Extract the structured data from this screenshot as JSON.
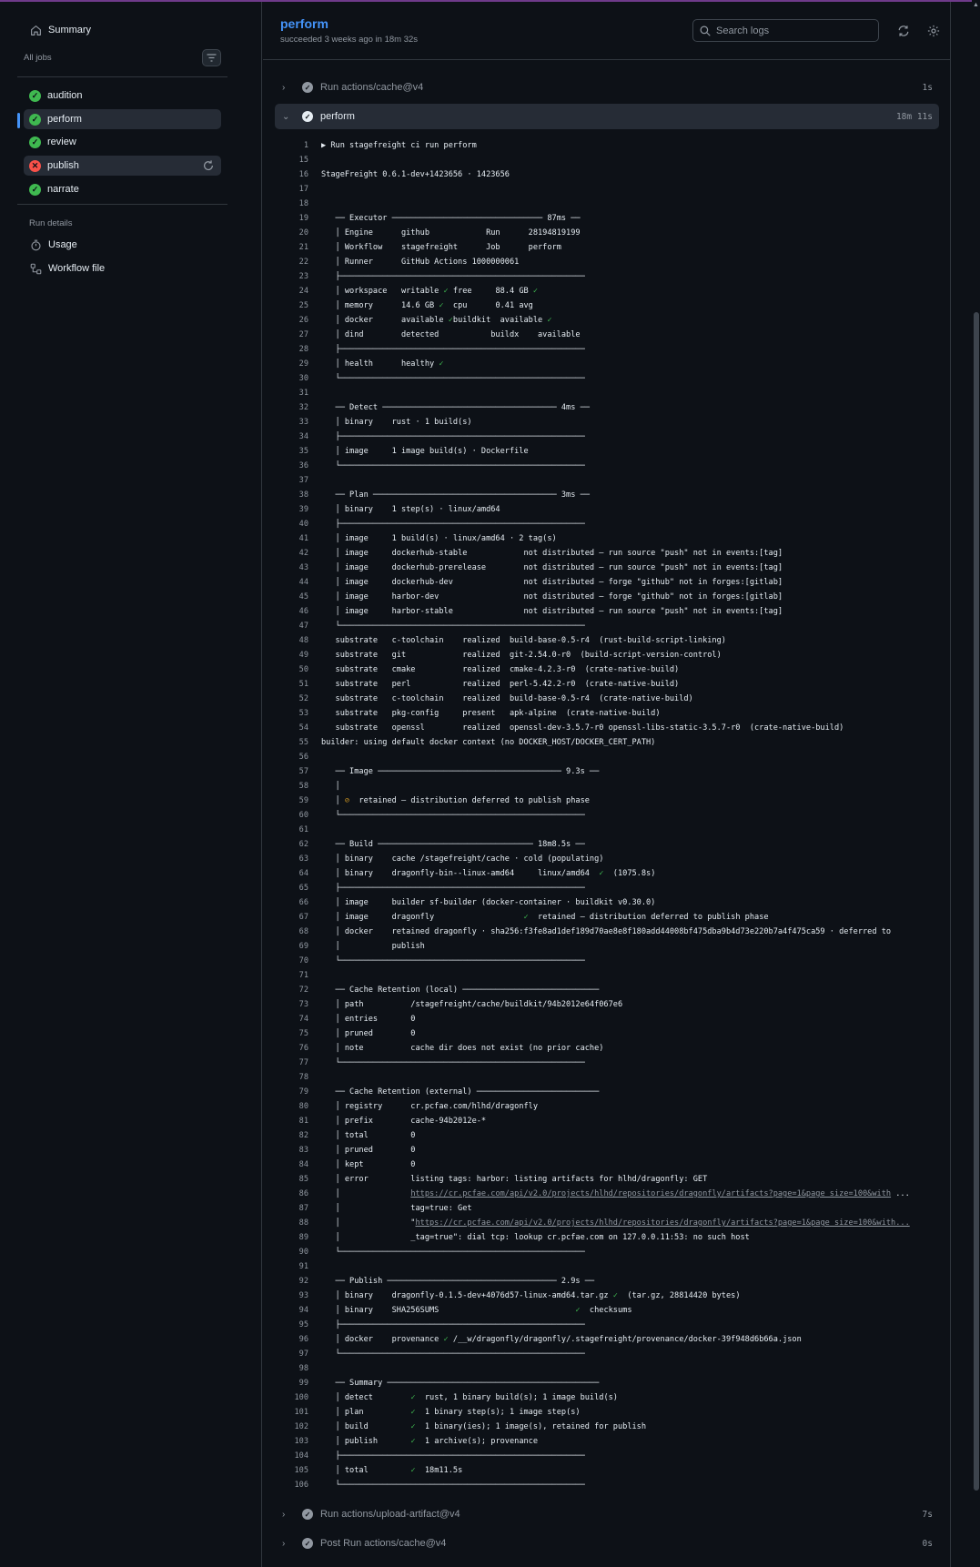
{
  "sidebar": {
    "summary": "Summary",
    "all_jobs": "All jobs",
    "jobs": [
      {
        "name": "audition",
        "status": "success"
      },
      {
        "name": "perform",
        "status": "success"
      },
      {
        "name": "review",
        "status": "success"
      },
      {
        "name": "publish",
        "status": "failure"
      },
      {
        "name": "narrate",
        "status": "success"
      }
    ],
    "run_details": "Run details",
    "usage": "Usage",
    "workflow_file": "Workflow file"
  },
  "header": {
    "title": "perform",
    "subtitle": "succeeded 3 weeks ago in 18m 32s",
    "search_placeholder": "Search logs"
  },
  "steps": {
    "cache": {
      "name": "Run actions/cache@v4",
      "duration": "1s"
    },
    "perform": {
      "name": "perform",
      "duration": "18m 11s"
    },
    "upload": {
      "name": "Run actions/upload-artifact@v4",
      "duration": "7s"
    },
    "post_cache": {
      "name": "Post Run actions/cache@v4",
      "duration": "0s"
    }
  },
  "log_lines": [
    {
      "n": "1",
      "t": "▶ Run stagefreight ci run perform"
    },
    {
      "n": "15",
      "t": ""
    },
    {
      "n": "16",
      "t": "StageFreight 0.6.1-dev+1423656 · 1423656",
      "c": "cyan"
    },
    {
      "n": "17",
      "t": ""
    },
    {
      "n": "18",
      "t": ""
    },
    {
      "n": "19",
      "t": "   ── Executor ──────────────────────────────── 87ms ──",
      "c": "cyan"
    },
    {
      "n": "20",
      "t": "   │ Engine      github            Run      28194819199"
    },
    {
      "n": "21",
      "t": "   │ Workflow    stagefreight      Job      perform"
    },
    {
      "n": "22",
      "t": "   │ Runner      GitHub Actions 1000000061"
    },
    {
      "n": "23",
      "t": "   ├────────────────────────────────────────────────────"
    },
    {
      "n": "24",
      "t": "   │ workspace   writable ✓ free     88.4 GB ✓"
    },
    {
      "n": "25",
      "t": "   │ memory      14.6 GB ✓  cpu      0.41 avg"
    },
    {
      "n": "26",
      "t": "   │ docker      available ✓buildkit  available ✓"
    },
    {
      "n": "27",
      "t": "   │ dind        detected           buildx    available"
    },
    {
      "n": "28",
      "t": "   ├────────────────────────────────────────────────────"
    },
    {
      "n": "29",
      "t": "   │ health      healthy ✓"
    },
    {
      "n": "30",
      "t": "   └────────────────────────────────────────────────────"
    },
    {
      "n": "31",
      "t": ""
    },
    {
      "n": "32",
      "t": "   ── Detect ───────────────────────────────────── 4ms ──",
      "c": "cyan"
    },
    {
      "n": "33",
      "t": "   │ binary    rust · 1 build(s)"
    },
    {
      "n": "34",
      "t": "   ├────────────────────────────────────────────────────"
    },
    {
      "n": "35",
      "t": "   │ image     1 image build(s) · Dockerfile"
    },
    {
      "n": "36",
      "t": "   └────────────────────────────────────────────────────"
    },
    {
      "n": "37",
      "t": ""
    },
    {
      "n": "38",
      "t": "   ── Plan ─────────────────────────────────────── 3ms ──",
      "c": "cyan"
    },
    {
      "n": "39",
      "t": "   │ binary    1 step(s) · linux/amd64"
    },
    {
      "n": "40",
      "t": "   ├────────────────────────────────────────────────────"
    },
    {
      "n": "41",
      "t": "   │ image     1 build(s) · linux/amd64 · 2 tag(s)"
    },
    {
      "n": "42",
      "t": "   │ image     dockerhub-stable            not distributed — run source \"push\" not in events:[tag]"
    },
    {
      "n": "43",
      "t": "   │ image     dockerhub-prerelease        not distributed — run source \"push\" not in events:[tag]"
    },
    {
      "n": "44",
      "t": "   │ image     dockerhub-dev               not distributed — forge \"github\" not in forges:[gitlab]"
    },
    {
      "n": "45",
      "t": "   │ image     harbor-dev                  not distributed — forge \"github\" not in forges:[gitlab]"
    },
    {
      "n": "46",
      "t": "   │ image     harbor-stable               not distributed — run source \"push\" not in events:[tag]"
    },
    {
      "n": "47",
      "t": "   └────────────────────────────────────────────────────"
    },
    {
      "n": "48",
      "t": "   substrate   c-toolchain    realized  build-base-0.5-r4  (rust-build-script-linking)"
    },
    {
      "n": "49",
      "t": "   substrate   git            realized  git-2.54.0-r0  (build-script-version-control)"
    },
    {
      "n": "50",
      "t": "   substrate   cmake          realized  cmake-4.2.3-r0  (crate-native-build)"
    },
    {
      "n": "51",
      "t": "   substrate   perl           realized  perl-5.42.2-r0  (crate-native-build)"
    },
    {
      "n": "52",
      "t": "   substrate   c-toolchain    realized  build-base-0.5-r4  (crate-native-build)"
    },
    {
      "n": "53",
      "t": "   substrate   pkg-config     present   apk-alpine  (crate-native-build)"
    },
    {
      "n": "54",
      "t": "   substrate   openssl        realized  openssl-dev-3.5.7-r0 openssl-libs-static-3.5.7-r0  (crate-native-build)"
    },
    {
      "n": "55",
      "t": "builder: using default docker context (no DOCKER_HOST/DOCKER_CERT_PATH)"
    },
    {
      "n": "56",
      "t": ""
    },
    {
      "n": "57",
      "t": "   ── Image ─────────────────────────────────────── 9.3s ──",
      "c": "cyan"
    },
    {
      "n": "58",
      "t": "   │"
    },
    {
      "n": "59",
      "t": "   │ ⊘  retained — distribution deferred to publish phase"
    },
    {
      "n": "60",
      "t": "   └────────────────────────────────────────────────────"
    },
    {
      "n": "61",
      "t": ""
    },
    {
      "n": "62",
      "t": "   ── Build ───────────────────────────────── 18m8.5s ──",
      "c": "cyan"
    },
    {
      "n": "63",
      "t": "   │ binary    cache /stagefreight/cache · cold (populating)"
    },
    {
      "n": "64",
      "t": "   │ binary    dragonfly-bin--linux-amd64     linux/amd64  ✓  (1075.8s)"
    },
    {
      "n": "65",
      "t": "   ├────────────────────────────────────────────────────"
    },
    {
      "n": "66",
      "t": "   │ image     builder sf-builder (docker-container · buildkit v0.30.0)"
    },
    {
      "n": "67",
      "t": "   │ image     dragonfly                   ✓  retained — distribution deferred to publish phase"
    },
    {
      "n": "68",
      "t": "   │ docker    retained dragonfly · sha256:f3fe8ad1def189d70ae8e8f180add44008bf475dba9b4d73e220b7a4f475ca59 · deferred to"
    },
    {
      "n": "69",
      "t": "   │           publish"
    },
    {
      "n": "70",
      "t": "   └────────────────────────────────────────────────────"
    },
    {
      "n": "71",
      "t": ""
    },
    {
      "n": "72",
      "t": "   ── Cache Retention (local) ─────────────────────────────",
      "c": "cyan"
    },
    {
      "n": "73",
      "t": "   │ path          /stagefreight/cache/buildkit/94b2012e64f067e6"
    },
    {
      "n": "74",
      "t": "   │ entries       0"
    },
    {
      "n": "75",
      "t": "   │ pruned        0"
    },
    {
      "n": "76",
      "t": "   │ note          cache dir does not exist (no prior cache)"
    },
    {
      "n": "77",
      "t": "   └────────────────────────────────────────────────────"
    },
    {
      "n": "78",
      "t": ""
    },
    {
      "n": "79",
      "t": "   ── Cache Retention (external) ──────────────────────────",
      "c": "cyan"
    },
    {
      "n": "80",
      "t": "   │ registry      cr.pcfae.com/hlhd/dragonfly"
    },
    {
      "n": "81",
      "t": "   │ prefix        cache-94b2012e-*"
    },
    {
      "n": "82",
      "t": "   │ total         0"
    },
    {
      "n": "83",
      "t": "   │ pruned        0"
    },
    {
      "n": "84",
      "t": "   │ kept          0"
    },
    {
      "n": "85",
      "t": "   │ error         listing tags: harbor: listing artifacts for hlhd/dragonfly: GET"
    },
    {
      "n": "86",
      "t": "   │               https://cr.pcfae.com/api/v2.0/projects/hlhd/repositories/dragonfly/artifacts?page=1&page_size=100&with ..."
    },
    {
      "n": "87",
      "t": "   │               tag=true: Get"
    },
    {
      "n": "88",
      "t": "   │               \"https://cr.pcfae.com/api/v2.0/projects/hlhd/repositories/dragonfly/artifacts?page=1&page_size=100&with..."
    },
    {
      "n": "89",
      "t": "   │               _tag=true\": dial tcp: lookup cr.pcfae.com on 127.0.0.11:53: no such host"
    },
    {
      "n": "90",
      "t": "   └────────────────────────────────────────────────────"
    },
    {
      "n": "91",
      "t": ""
    },
    {
      "n": "92",
      "t": "   ── Publish ──────────────────────────────────── 2.9s ──",
      "c": "cyan"
    },
    {
      "n": "93",
      "t": "   │ binary    dragonfly-0.1.5-dev+4076d57-linux-amd64.tar.gz ✓  (tar.gz, 28814420 bytes)"
    },
    {
      "n": "94",
      "t": "   │ binary    SHA256SUMS                             ✓  checksums"
    },
    {
      "n": "95",
      "t": "   ├────────────────────────────────────────────────────"
    },
    {
      "n": "96",
      "t": "   │ docker    provenance ✓ /__w/dragonfly/dragonfly/.stagefreight/provenance/docker-39f948d6b66a.json"
    },
    {
      "n": "97",
      "t": "   └────────────────────────────────────────────────────"
    },
    {
      "n": "98",
      "t": ""
    },
    {
      "n": "99",
      "t": "   ── Summary ─────────────────────────────────────────────",
      "c": "cyan"
    },
    {
      "n": "100",
      "t": "   │ detect        ✓  rust, 1 binary build(s); 1 image build(s)"
    },
    {
      "n": "101",
      "t": "   │ plan          ✓  1 binary step(s); 1 image step(s)"
    },
    {
      "n": "102",
      "t": "   │ build         ✓  1 binary(ies); 1 image(s), retained for publish"
    },
    {
      "n": "103",
      "t": "   │ publish       ✓  1 archive(s); provenance"
    },
    {
      "n": "104",
      "t": "   ├────────────────────────────────────────────────────"
    },
    {
      "n": "105",
      "t": "   │ total         ✓  18m11.5s"
    },
    {
      "n": "106",
      "t": "   └────────────────────────────────────────────────────"
    }
  ],
  "colors": {
    "accent": "#4493f8",
    "success": "#3fb950",
    "failure": "#f85149",
    "cyan": "#39c5cf"
  }
}
